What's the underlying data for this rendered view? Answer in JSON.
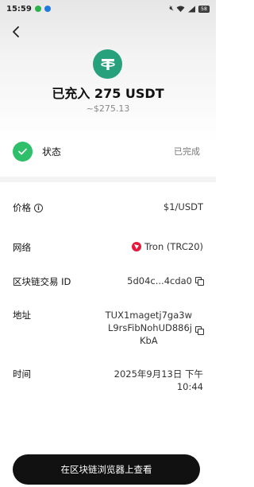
{
  "status_bar": {
    "time": "15:59",
    "icons": [
      "wechat-icon",
      "app-icon",
      "mute-icon",
      "wifi-icon",
      "signal-icon",
      "battery-icon"
    ],
    "battery": "58"
  },
  "header": {
    "back_icon": "chevron-left-icon"
  },
  "summary": {
    "coin_icon": "tether-usdt-icon",
    "amount_text": "已充入 275  USDT",
    "fiat_text": "~$275.13",
    "coin_color": "#26a17b"
  },
  "status": {
    "label": "状态",
    "value": "已完成",
    "check_color": "#2fbf6a"
  },
  "details": {
    "price": {
      "label": "价格",
      "value": "$1/USDT"
    },
    "network": {
      "label": "网络",
      "value": "Tron (TRC20)",
      "icon": "tron-icon",
      "icon_color": "#e5193b"
    },
    "txid": {
      "label": "区块链交易 ID",
      "value": "5d04c...4cda0"
    },
    "address": {
      "label": "地址",
      "line1": "TUX1magetj7ga3w",
      "line2": "L9rsFibNohUD886j",
      "line3": "KbA"
    },
    "time": {
      "label": "时间",
      "line1": "2025年9月13日 下午",
      "line2": "10:44"
    }
  },
  "footer": {
    "button_label": "在区块链浏览器上查看"
  }
}
